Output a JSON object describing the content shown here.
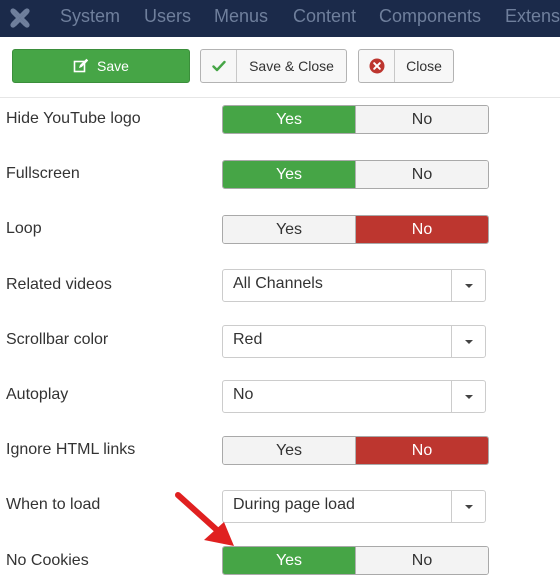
{
  "topbar": {
    "logo_icon": "joomla-logo-icon",
    "nav": [
      "System",
      "Users",
      "Menus",
      "Content",
      "Components",
      "Extens"
    ]
  },
  "toolbar": {
    "save_label": "Save",
    "save_close_label": "Save & Close",
    "close_label": "Close"
  },
  "colors": {
    "topbar_bg": "#1b2a4a",
    "green": "#46a546",
    "red": "#bd362f",
    "arrow": "#e02020"
  },
  "fields": [
    {
      "label": "Hide YouTube logo",
      "type": "toggle",
      "yes": "Yes",
      "no": "No",
      "value": "Yes"
    },
    {
      "label": "Fullscreen",
      "type": "toggle",
      "yes": "Yes",
      "no": "No",
      "value": "Yes"
    },
    {
      "label": "Loop",
      "type": "toggle",
      "yes": "Yes",
      "no": "No",
      "value": "No"
    },
    {
      "label": "Related videos",
      "type": "select",
      "value": "All Channels"
    },
    {
      "label": "Scrollbar color",
      "type": "select",
      "value": "Red"
    },
    {
      "label": "Autoplay",
      "type": "select",
      "value": "No"
    },
    {
      "label": "Ignore HTML links",
      "type": "toggle",
      "yes": "Yes",
      "no": "No",
      "value": "No"
    },
    {
      "label": "When to load",
      "type": "select",
      "value": "During page load"
    },
    {
      "label": "No Cookies",
      "type": "toggle",
      "yes": "Yes",
      "no": "No",
      "value": "Yes"
    }
  ],
  "annotation": {
    "icon": "red-arrow-icon"
  }
}
